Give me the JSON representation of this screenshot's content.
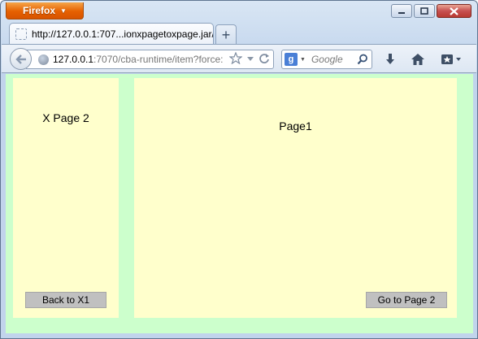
{
  "browser": {
    "app_button_label": "Firefox",
    "tab": {
      "title": "http://127.0.0.1:707...ionxpagetoxpage.jar/"
    },
    "new_tab_symbol": "+",
    "url": {
      "host": "127.0.0.1",
      "rest": ":7070/cba-runtime/item?force:"
    },
    "search": {
      "engine_letter": "g",
      "placeholder": "Google"
    },
    "icons": [
      "back-icon",
      "globe-icon",
      "star-icon",
      "dropdown-icon",
      "reload-icon",
      "search-icon",
      "download-icon",
      "home-icon",
      "bookmarks-icon",
      "minimize-icon",
      "maximize-icon",
      "close-icon"
    ]
  },
  "page": {
    "left_panel": {
      "title": "X Page 2",
      "button_label": "Back to X1"
    },
    "main_panel": {
      "title": "Page1",
      "button_label": "Go to Page 2"
    }
  },
  "colors": {
    "background": "#ccffcc",
    "panel": "#ffffcc",
    "button": "#c0c0c0",
    "firefox_orange": "#e66000"
  }
}
